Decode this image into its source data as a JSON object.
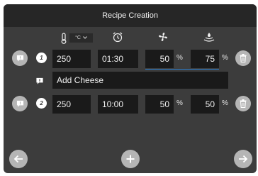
{
  "title": "Recipe Creation",
  "header": {
    "temp_unit": "°C",
    "icons": [
      "thermometer-icon",
      "alarm-clock-icon",
      "fan-icon",
      "humidity-icon"
    ]
  },
  "steps": [
    {
      "number": "1",
      "temperature": "250",
      "time": "01:30",
      "fan": "50",
      "humidity": "75"
    },
    {
      "number": "2",
      "temperature": "250",
      "time": "10:00",
      "fan": "50",
      "humidity": "50"
    }
  ],
  "note": {
    "text": "Add Cheese"
  },
  "percent_sign": "%",
  "colors": {
    "background": "#3c3c3c",
    "titlebar": "#262626",
    "field": "#1a1a1a",
    "button": "#b5b5b5",
    "accent": "#2d7fd0"
  }
}
